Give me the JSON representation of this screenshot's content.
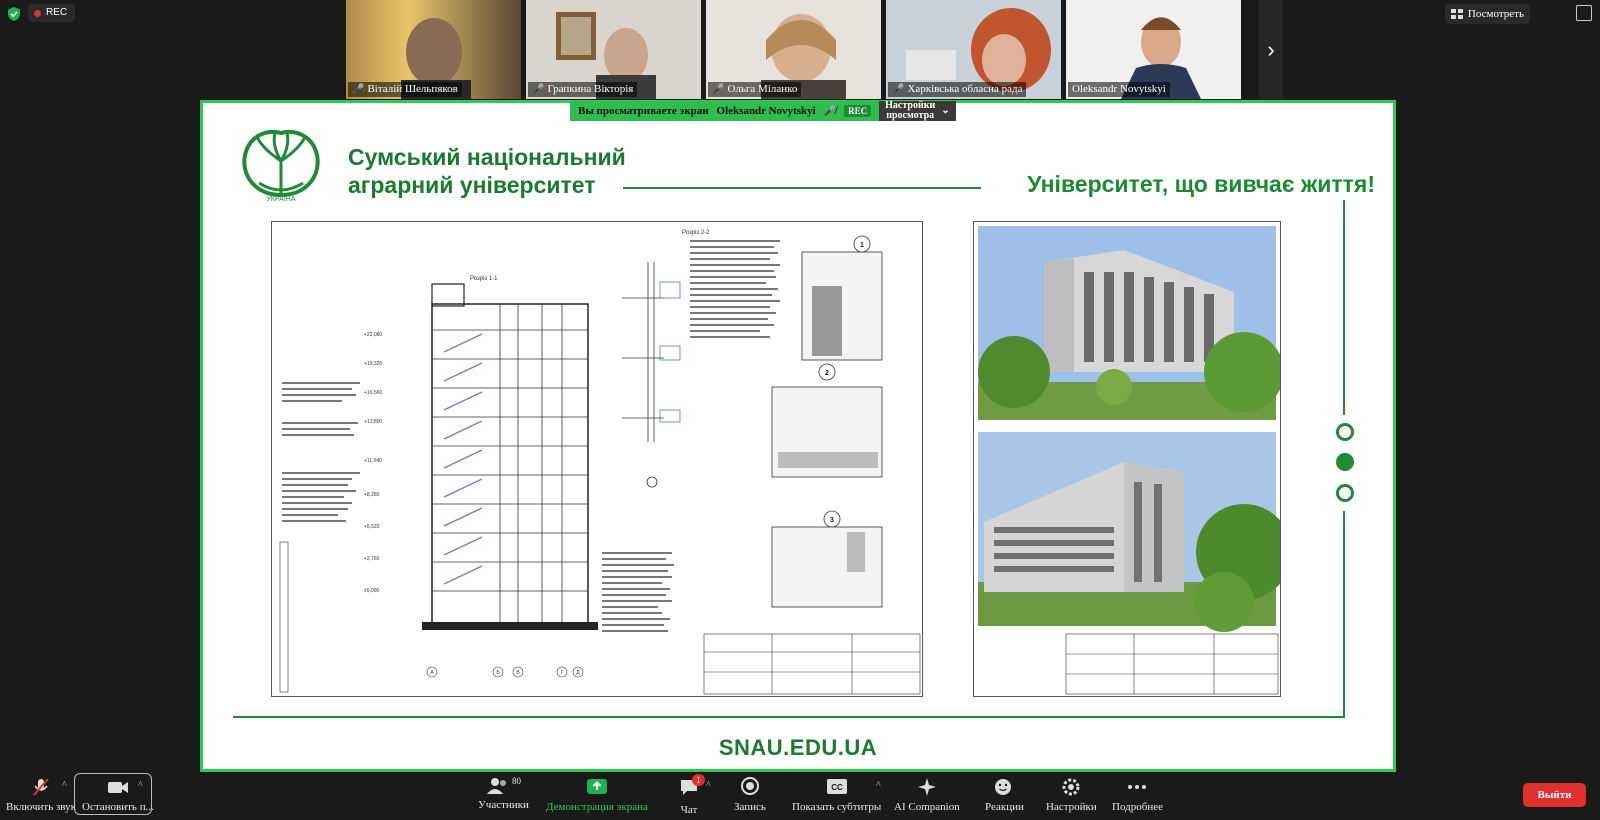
{
  "topbar": {
    "rec_label": "REC",
    "view_label": "Посмотреть",
    "next_icon": "chevron-right-icon"
  },
  "participants": [
    {
      "name": "Віталій Шельпяков",
      "muted": true
    },
    {
      "name": "Грапкина Вікторія",
      "muted": true
    },
    {
      "name": "Ольга Міланко",
      "muted": true
    },
    {
      "name": "Харківська обласна рада",
      "muted": true
    },
    {
      "name": "Oleksandr Novytskyi",
      "muted": false
    }
  ],
  "share_banner": {
    "viewing_text": "Вы просматриваете экран",
    "presenter": "Oleksandr Novytskyi",
    "rec_label": "REC",
    "settings_line1": "Настройки",
    "settings_line2": "просмотра"
  },
  "slide": {
    "university_line1": "Сумський національний",
    "university_line2": "аграрний університет",
    "slogan": "Університет, що вивчає життя!",
    "website": "SNAU.EDU.UA",
    "logo_text": "УКРАЇНА",
    "brand_color": "#1b7a2f",
    "drawing_titles": [
      "Розріз 1-1",
      "Розріз 2-2"
    ],
    "detail_numbers": [
      "1",
      "2",
      "3"
    ],
    "level_marks": [
      "+22,080",
      "+19,320",
      "+16,560",
      "+13,800",
      "+11,040",
      "+8,280",
      "+5,520",
      "+2,760",
      "±0,000"
    ],
    "axis_labels": [
      "А",
      "Б",
      "В",
      "Г",
      "Д"
    ],
    "nav_dots": [
      false,
      true,
      false
    ]
  },
  "bottombar": {
    "items": [
      {
        "label": "Включить звук",
        "icon": "mic-off-icon"
      },
      {
        "label": "Остановить п...",
        "icon": "video-camera-icon"
      },
      {
        "label": "Участники",
        "icon": "participants-icon",
        "count": "80"
      },
      {
        "label": "Демонстрация экрана",
        "icon": "share-screen-icon"
      },
      {
        "label": "Чат",
        "icon": "chat-icon",
        "badge": "1"
      },
      {
        "label": "Запись",
        "icon": "record-icon"
      },
      {
        "label": "Показать субтитры",
        "icon": "captions-icon"
      },
      {
        "label": "AI Companion",
        "icon": "sparkle-icon"
      },
      {
        "label": "Реакции",
        "icon": "reactions-icon"
      },
      {
        "label": "Настройки",
        "icon": "gear-icon"
      },
      {
        "label": "Подробнее",
        "icon": "more-icon"
      }
    ],
    "leave_label": "Выйти",
    "accent_green": "#2dcb4f",
    "leave_color": "#e02f2f"
  }
}
